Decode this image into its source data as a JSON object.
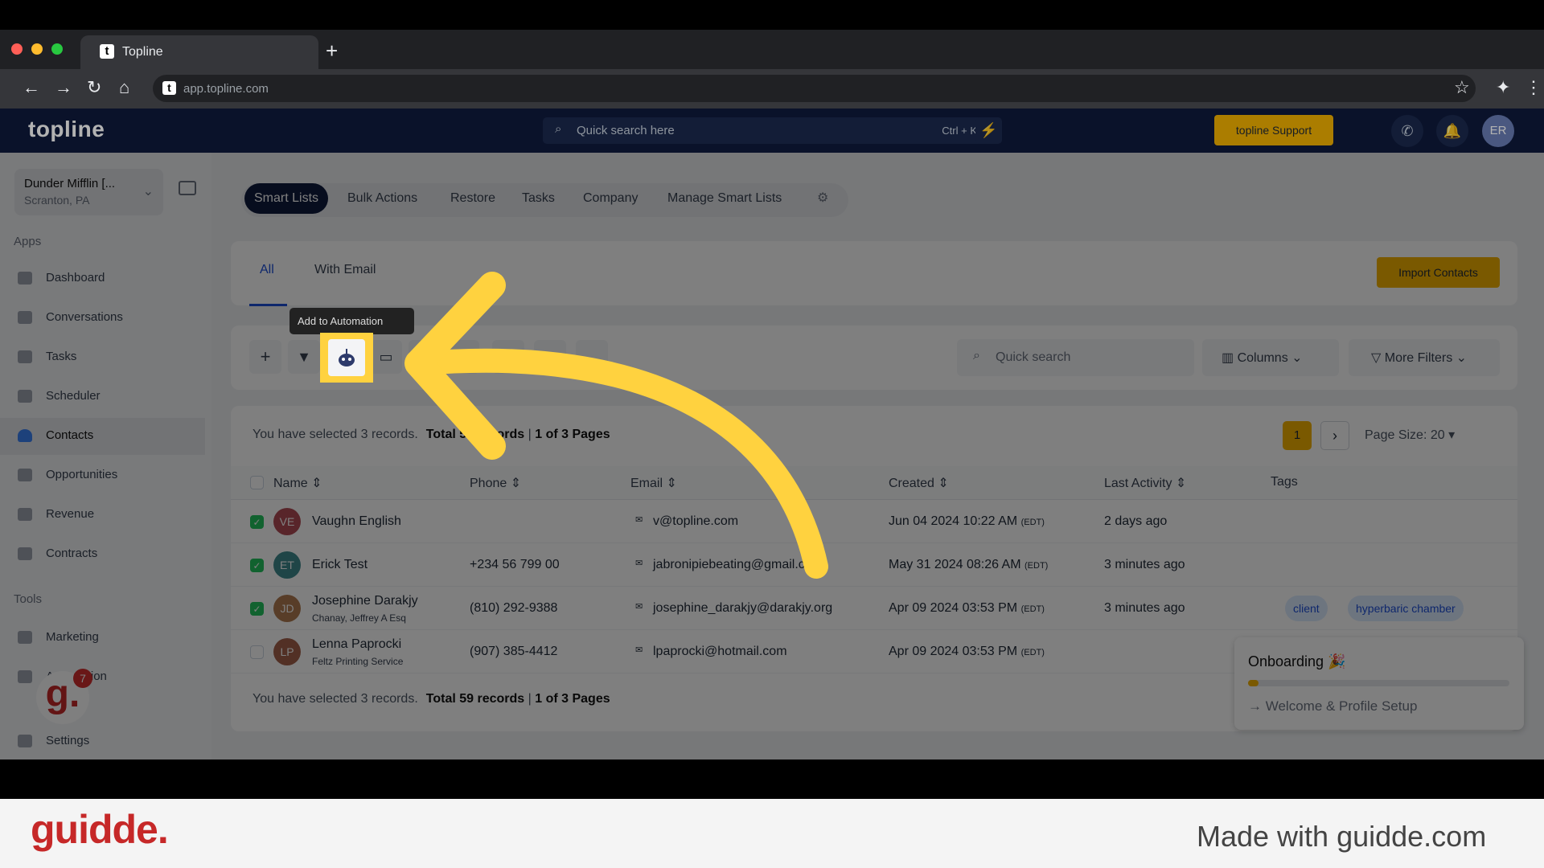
{
  "browser": {
    "tab_title": "Topline",
    "url": "app.topline.com",
    "new_tab": "+"
  },
  "header": {
    "logo": "topline",
    "search_placeholder": "Quick search here",
    "search_shortcut": "Ctrl + K",
    "support_label": "topline Support",
    "avatar": "ER"
  },
  "sidebar": {
    "location_name": "Dunder Mifflin [...",
    "location_sub": "Scranton, PA",
    "apps_label": "Apps",
    "tools_label": "Tools",
    "items": [
      {
        "label": "Dashboard"
      },
      {
        "label": "Conversations"
      },
      {
        "label": "Tasks"
      },
      {
        "label": "Scheduler"
      },
      {
        "label": "Contacts",
        "active": true
      },
      {
        "label": "Opportunities"
      },
      {
        "label": "Revenue"
      },
      {
        "label": "Contracts"
      }
    ],
    "tools": [
      {
        "label": "Marketing"
      },
      {
        "label": "Automation"
      },
      {
        "label": "Settings"
      }
    ],
    "notification_count": "7"
  },
  "topnav": [
    {
      "label": "Smart Lists",
      "active": true
    },
    {
      "label": "Bulk Actions"
    },
    {
      "label": "Restore"
    },
    {
      "label": "Tasks"
    },
    {
      "label": "Company"
    },
    {
      "label": "Manage Smart Lists"
    }
  ],
  "subtabs": [
    {
      "label": "All",
      "active": true
    },
    {
      "label": "With Email"
    }
  ],
  "import_label": "Import Contacts",
  "toolbar": {
    "tooltip": "Add to Automation",
    "quick_search": "Quick search",
    "columns": "Columns",
    "more_filters": "More Filters"
  },
  "selection": {
    "text": "You have selected 3 records.",
    "total": "Total 59 records",
    "pages": "1 of 3 Pages"
  },
  "pagination": {
    "current": "1",
    "page_size": "Page Size: 20"
  },
  "table": {
    "headers": [
      "Name",
      "Phone",
      "Email",
      "Created",
      "Last Activity",
      "Tags"
    ],
    "rows": [
      {
        "checked": true,
        "initials": "VE",
        "color": "#b04a55",
        "name": "Vaughn English",
        "sub": "",
        "phone": "",
        "email": "v@topline.com",
        "created": "Jun 04 2024 10:22 AM",
        "tz": "(EDT)",
        "activity": "2 days ago",
        "tags": []
      },
      {
        "checked": true,
        "initials": "ET",
        "color": "#3f8a8f",
        "name": "Erick Test",
        "sub": "",
        "phone": "+234 56 799 00",
        "email": "jabronipiebeating@gmail.com",
        "created": "May 31 2024 08:26 AM",
        "tz": "(EDT)",
        "activity": "3 minutes ago",
        "tags": []
      },
      {
        "checked": true,
        "initials": "JD",
        "color": "#b07a50",
        "name": "Josephine Darakjy",
        "sub": "Chanay, Jeffrey A Esq",
        "phone": "(810) 292-9388",
        "email": "josephine_darakjy@darakjy.org",
        "created": "Apr 09 2024 03:53 PM",
        "tz": "(EDT)",
        "activity": "3 minutes ago",
        "tags": [
          "client",
          "hyperbaric chamber"
        ]
      },
      {
        "checked": false,
        "initials": "LP",
        "color": "#a5604a",
        "name": "Lenna Paprocki",
        "sub": "Feltz Printing Service",
        "phone": "(907) 385-4412",
        "email": "lpaprocki@hotmail.com",
        "created": "Apr 09 2024 03:53 PM",
        "tz": "(EDT)",
        "activity": "",
        "tags": []
      }
    ]
  },
  "onboarding": {
    "title": "Onboarding",
    "step": "Welcome & Profile Setup",
    "progress_percent": 4
  },
  "footer": {
    "brand": "guidde.",
    "made_with": "Made with guidde.com"
  },
  "colors": {
    "accent": "#f5b301",
    "highlight": "#ffd23f",
    "navy": "#0f1b3d"
  }
}
